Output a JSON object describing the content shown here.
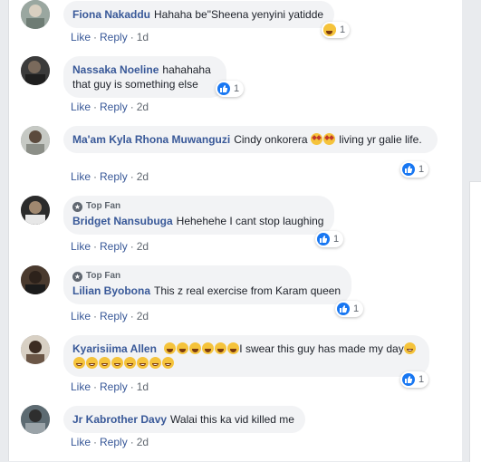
{
  "actions": {
    "like": "Like",
    "reply": "Reply",
    "sep": "·"
  },
  "top_fan_label": "Top Fan",
  "comments": [
    {
      "author": "Fiona Nakaddu",
      "text": "Hahaha be\"Sheena yenyini yatidde",
      "time": "1d",
      "reaction": "haha",
      "reaction_count": "1"
    },
    {
      "author": "Nassaka Noeline",
      "text": "hahahaha that guy is something else",
      "time": "2d",
      "reaction": "like",
      "reaction_count": "1"
    },
    {
      "author": "Ma'am Kyla Rhona Muwanguzi",
      "text_before": "Cindy onkorera",
      "text_after": "living yr galie life.",
      "time": "2d",
      "reaction": "like",
      "reaction_count": "1"
    },
    {
      "author": "Bridget Nansubuga",
      "text": "Hehehehe I cant stop laughing",
      "time": "2d",
      "reaction": "like",
      "reaction_count": "1",
      "top_fan": true
    },
    {
      "author": "Lilian Byobona",
      "text": "This z real exercise from Karam queen",
      "time": "2d",
      "reaction": "like",
      "reaction_count": "1",
      "top_fan": true
    },
    {
      "author": "Kyarisiima Allen",
      "text": "I swear this guy has made my day",
      "time": "1d",
      "reaction": "like",
      "reaction_count": "1"
    },
    {
      "author": "Jr Kabrother Davy",
      "text": "Walai this ka vid killed me",
      "time": "2d"
    }
  ]
}
